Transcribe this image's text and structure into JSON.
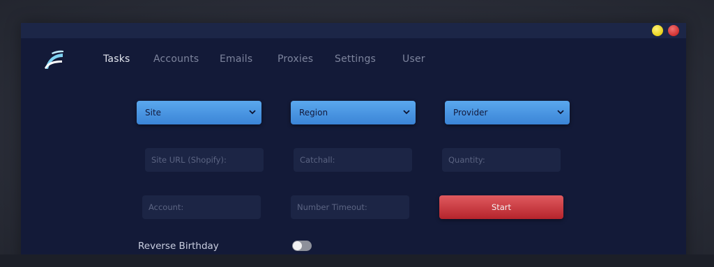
{
  "window": {
    "controls": [
      "minimize-dot",
      "close-dot"
    ],
    "colors": {
      "minimize": "#e8d21a",
      "close": "#d03030"
    }
  },
  "logo": {
    "icon": "wave-logo-icon",
    "colors": [
      "#7fd3f2",
      "#ffffff"
    ]
  },
  "nav": {
    "items": [
      {
        "label": "Tasks",
        "active": true
      },
      {
        "label": "Accounts",
        "active": false
      },
      {
        "label": "Emails",
        "active": false
      },
      {
        "label": "Proxies",
        "active": false
      },
      {
        "label": "Settings",
        "active": false
      },
      {
        "label": "User",
        "active": false
      }
    ]
  },
  "selects": {
    "site": {
      "value": "Site",
      "icon": "chevron-down-icon"
    },
    "region": {
      "value": "Region",
      "icon": "chevron-down-icon"
    },
    "provider": {
      "value": "Provider",
      "icon": "chevron-down-icon"
    }
  },
  "fields": {
    "site_url": {
      "placeholder": "Site URL (Shopify):",
      "value": ""
    },
    "catchall": {
      "placeholder": "Catchall:",
      "value": ""
    },
    "quantity": {
      "placeholder": "Quantity:",
      "value": ""
    },
    "account": {
      "placeholder": "Account:",
      "value": ""
    },
    "number_timeout": {
      "placeholder": "Number Timeout:",
      "value": ""
    }
  },
  "start_button": {
    "label": "Start",
    "color": "#c8353c"
  },
  "reverse_birthday": {
    "label": "Reverse Birthday",
    "enabled": false
  },
  "colors": {
    "window_bg": "#131a38",
    "accent_blue": "#4a96e2",
    "field_bg": "#1c2545"
  }
}
